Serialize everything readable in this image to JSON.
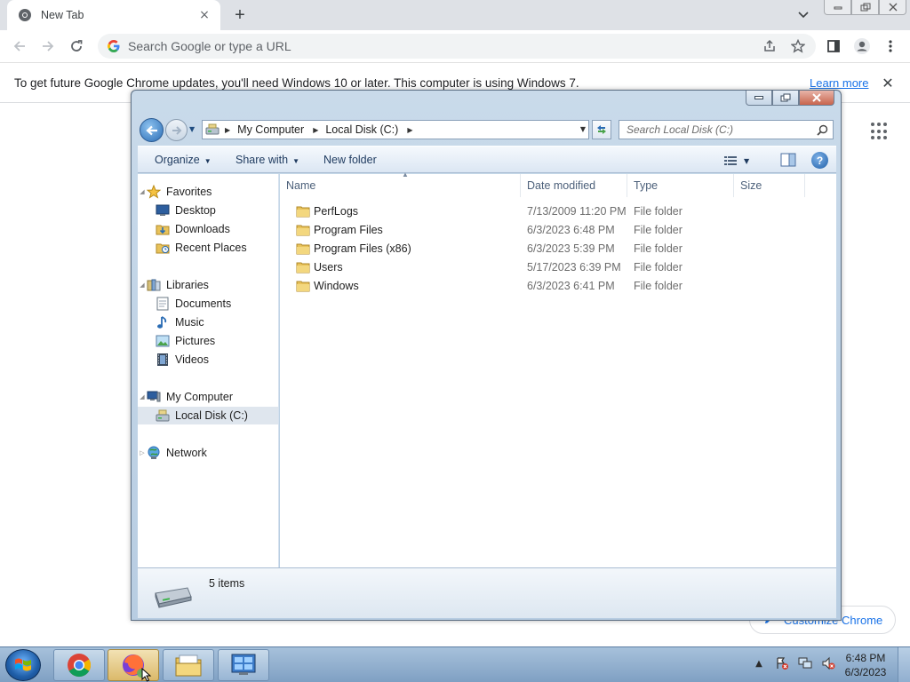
{
  "chrome": {
    "tab": {
      "title": "New Tab",
      "favicon": "chrome-logo-icon",
      "close": "×"
    },
    "new_tab": "+",
    "omnibox": {
      "placeholder": "Search Google or type a URL"
    },
    "infobar": {
      "message": "To get future Google Chrome updates, you'll need Windows 10 or later. This computer is using Windows 7.",
      "link": "Learn more",
      "close": "✕"
    },
    "customize_label": "Customize Chrome"
  },
  "explorer": {
    "breadcrumbs": [
      "My Computer",
      "Local Disk (C:)"
    ],
    "search_placeholder": "Search Local Disk (C:)",
    "commands": {
      "organize": "Organize",
      "share_with": "Share with",
      "new_folder": "New folder"
    },
    "nav": {
      "favorites": "Favorites",
      "favorites_items": [
        "Desktop",
        "Downloads",
        "Recent Places"
      ],
      "libraries": "Libraries",
      "libraries_items": [
        "Documents",
        "Music",
        "Pictures",
        "Videos"
      ],
      "computer": "My Computer",
      "computer_items": [
        "Local Disk (C:)"
      ],
      "network": "Network"
    },
    "columns": {
      "name": "Name",
      "date": "Date modified",
      "type": "Type",
      "size": "Size"
    },
    "files": [
      {
        "name": "PerfLogs",
        "date": "7/13/2009 11:20 PM",
        "type": "File folder"
      },
      {
        "name": "Program Files",
        "date": "6/3/2023 6:48 PM",
        "type": "File folder"
      },
      {
        "name": "Program Files (x86)",
        "date": "6/3/2023 5:39 PM",
        "type": "File folder"
      },
      {
        "name": "Users",
        "date": "5/17/2023 6:39 PM",
        "type": "File folder"
      },
      {
        "name": "Windows",
        "date": "6/3/2023 6:41 PM",
        "type": "File folder"
      }
    ],
    "status": "5 items"
  },
  "taskbar": {
    "apps": [
      "chrome-icon",
      "firefox-icon",
      "explorer-folder-icon",
      "control-panel-icon"
    ],
    "clock": {
      "time": "6:48 PM",
      "date": "6/3/2023"
    }
  },
  "colors": {
    "accent": "#1a73e8",
    "win7_frame": "#c9daea",
    "folder": "#e8c25a"
  }
}
